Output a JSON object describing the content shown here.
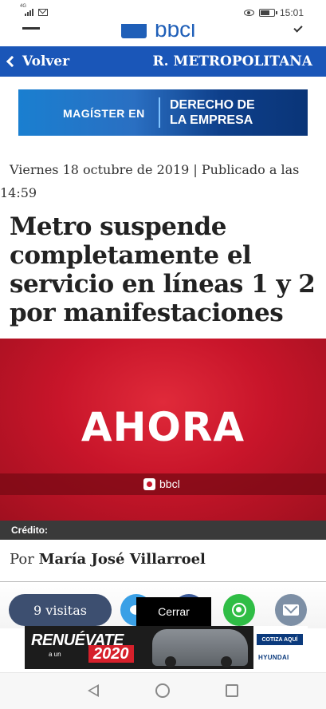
{
  "status_bar": {
    "network_type": "4G",
    "time": "15:01"
  },
  "app_header": {
    "brand": "bbcl"
  },
  "nav": {
    "back_label": "Volver",
    "section": "R. METROPOLITANA"
  },
  "ad_top": {
    "left_text": "MAGÍSTER EN",
    "right_line1": "DERECHO DE",
    "right_line2": "LA EMPRESA"
  },
  "article": {
    "date_line1": "Viernes 18 octubre de 2019 | Publicado a las",
    "date_line2": "14:59",
    "headline": "Metro suspende completamente el servicio en líneas 1 y 2 por manifestaciones",
    "image_text": "AHORA",
    "image_brand": "bbcl",
    "credit_label": "Crédito:",
    "author_prefix": "Por",
    "author_name": "María José Villarroel"
  },
  "share": {
    "visits": "9 visitas",
    "close_label": "Cerrar",
    "icons": [
      "twitter-icon",
      "facebook-icon",
      "whatsapp-icon",
      "email-icon"
    ]
  },
  "ad_bottom": {
    "headline": "RENUÉVATE",
    "small_text": "a un",
    "year": "2020",
    "cta": "COTIZA AQUÍ",
    "brand": "HYUNDAI"
  },
  "colors": {
    "nav_blue": "#1a56b8",
    "hero_red": "#c8152a",
    "pill_blue": "#3d4f70",
    "whatsapp_green": "#2fbd45",
    "twitter_blue": "#3aa0e6"
  }
}
